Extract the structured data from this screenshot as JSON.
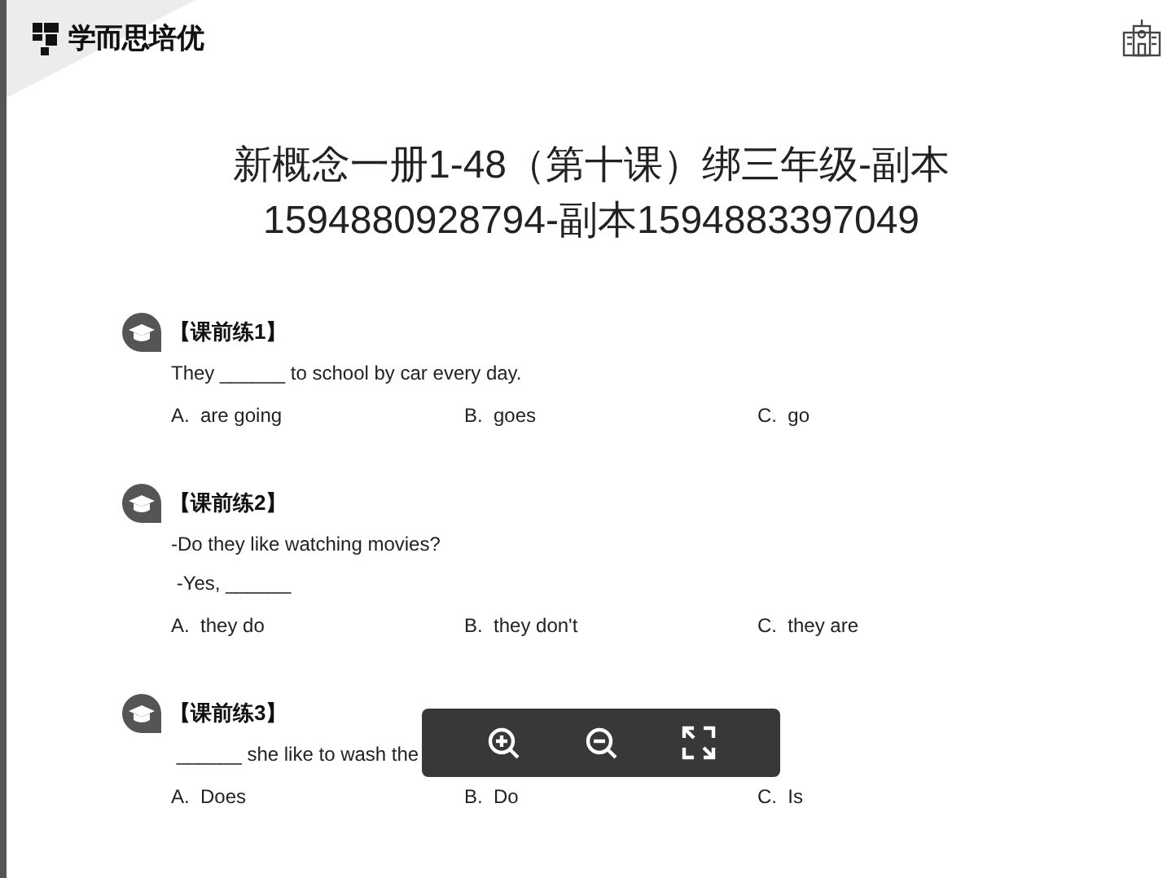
{
  "header": {
    "logo_text": "学而思培优"
  },
  "title_lines": [
    "新概念一册1-48（第十课）绑三年级-副本",
    "1594880928794-副本1594883397049"
  ],
  "questions": [
    {
      "label": "【课前练1】",
      "lines": [
        "They ______ to school by car every day."
      ],
      "options": [
        {
          "letter": "A.",
          "text": "are going"
        },
        {
          "letter": "B.",
          "text": "goes"
        },
        {
          "letter": "C.",
          "text": "go"
        }
      ]
    },
    {
      "label": "【课前练2】",
      "lines": [
        "-Do they like watching movies?",
        " -Yes, ______"
      ],
      "options": [
        {
          "letter": "A.",
          "text": "they do"
        },
        {
          "letter": "B.",
          "text": "they don't"
        },
        {
          "letter": "C.",
          "text": "they are"
        }
      ]
    },
    {
      "label": "【课前练3】",
      "lines": [
        " ______ she like to wash the"
      ],
      "options": [
        {
          "letter": "A.",
          "text": "Does"
        },
        {
          "letter": "B.",
          "text": "Do"
        },
        {
          "letter": "C.",
          "text": "Is"
        }
      ]
    }
  ],
  "viewer_toolbar": [
    {
      "kind": "zoom-in"
    },
    {
      "kind": "zoom-out"
    },
    {
      "kind": "fullscreen"
    }
  ]
}
